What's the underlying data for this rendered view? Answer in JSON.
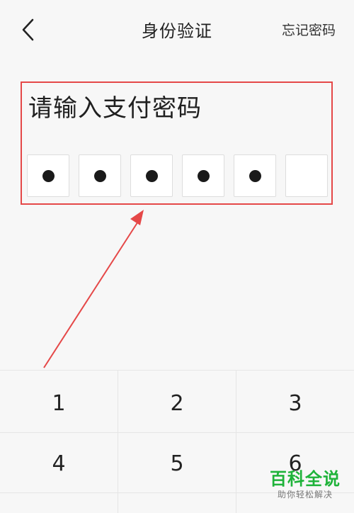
{
  "header": {
    "title": "身份验证",
    "forgot_label": "忘记密码",
    "back_icon": "chevron-left-icon"
  },
  "prompt": "请输入支付密码",
  "pin": {
    "length": 6,
    "filled": [
      true,
      true,
      true,
      true,
      true,
      false
    ]
  },
  "keypad": {
    "keys": [
      "1",
      "2",
      "3",
      "4",
      "5",
      "6"
    ]
  },
  "colors": {
    "annotation": "#e54848",
    "watermark": "#1fb33a"
  },
  "watermark": {
    "title": "百科全说",
    "subtitle": "助你轻松解决"
  }
}
